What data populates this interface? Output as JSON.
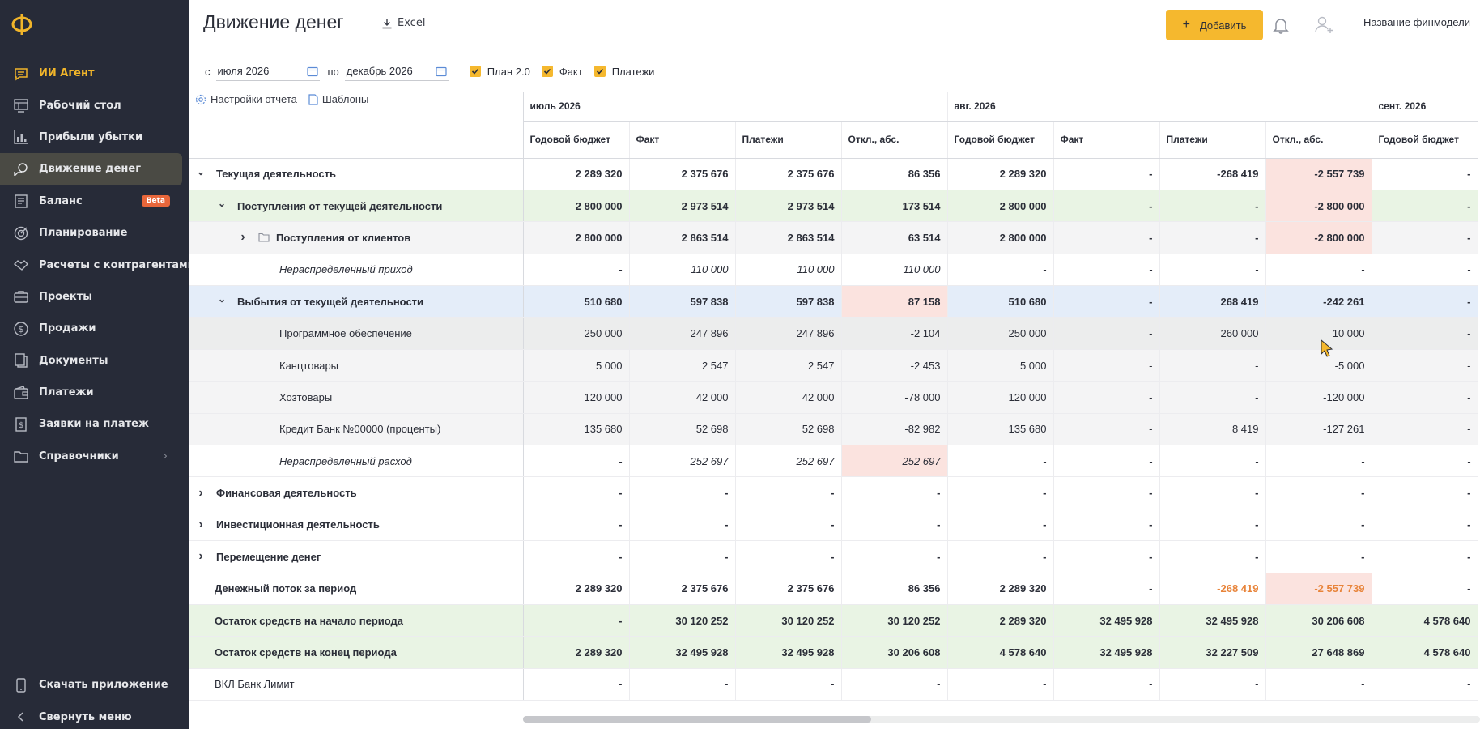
{
  "sidebar": {
    "items": [
      {
        "label": "ИИ Агент",
        "icon": "chat-icon"
      },
      {
        "label": "Рабочий стол",
        "icon": "dashboard-icon"
      },
      {
        "label": "Прибыли убытки",
        "icon": "bar-chart-icon"
      },
      {
        "label": "Движение денег",
        "icon": "money-flow-icon"
      },
      {
        "label": "Баланс",
        "icon": "balance-icon",
        "badge": "Beta"
      },
      {
        "label": "Планирование",
        "icon": "target-icon"
      },
      {
        "label": "Расчеты с контрагентами",
        "icon": "handshake-icon"
      },
      {
        "label": "Проекты",
        "icon": "briefcase-icon"
      },
      {
        "label": "Продажи",
        "icon": "dollar-icon"
      },
      {
        "label": "Документы",
        "icon": "documents-icon"
      },
      {
        "label": "Платежи",
        "icon": "wallet-icon"
      },
      {
        "label": "Заявки на платеж",
        "icon": "request-icon"
      },
      {
        "label": "Справочники",
        "icon": "folder-icon"
      }
    ],
    "download_app": "Скачать приложение",
    "collapse_menu": "Свернуть меню"
  },
  "header": {
    "title": "Движение денег",
    "excel": "Excel",
    "add_button": "Добавить",
    "model_name": "Название финмодели"
  },
  "filters": {
    "from_label": "с",
    "from_value": "июля 2026",
    "to_label": "по",
    "to_value": "декабрь 2026",
    "checks": [
      "План 2.0",
      "Факт",
      "Платежи"
    ]
  },
  "settings": {
    "report_settings": "Настройки отчета",
    "templates": "Шаблоны"
  },
  "table": {
    "months": [
      "июль 2026",
      "авг. 2026",
      "сент. 2026"
    ],
    "columns": [
      "Годовой бюджет",
      "Факт",
      "Платежи",
      "Откл., абс.",
      "Годовой бюджет",
      "Факт",
      "Платежи",
      "Откл., абс.",
      "Годовой бюджет"
    ],
    "rows": [
      {
        "name": "Текущая деятельность",
        "values": [
          "2 289 320",
          "2 375 676",
          "2 375 676",
          "86 356",
          "2 289 320",
          "-",
          "-268 419",
          "-2 557 739",
          "-"
        ]
      },
      {
        "name": "Поступления от текущей деятельности",
        "values": [
          "2 800 000",
          "2 973 514",
          "2 973 514",
          "173 514",
          "2 800 000",
          "-",
          "-",
          "-2 800 000",
          "-"
        ]
      },
      {
        "name": "Поступления от клиентов",
        "values": [
          "2 800 000",
          "2 863 514",
          "2 863 514",
          "63 514",
          "2 800 000",
          "-",
          "-",
          "-2 800 000",
          "-"
        ]
      },
      {
        "name": "Нераспределенный приход",
        "values": [
          "-",
          "110 000",
          "110 000",
          "110 000",
          "-",
          "-",
          "-",
          "-",
          "-"
        ]
      },
      {
        "name": "Выбытия от текущей деятельности",
        "values": [
          "510 680",
          "597 838",
          "597 838",
          "87 158",
          "510 680",
          "-",
          "268 419",
          "-242 261",
          "-"
        ]
      },
      {
        "name": "Программное обеспечение",
        "values": [
          "250 000",
          "247 896",
          "247 896",
          "-2 104",
          "250 000",
          "-",
          "260 000",
          "10 000",
          "-"
        ]
      },
      {
        "name": "Канцтовары",
        "values": [
          "5 000",
          "2 547",
          "2 547",
          "-2 453",
          "5 000",
          "-",
          "-",
          "-5 000",
          "-"
        ]
      },
      {
        "name": "Хозтовары",
        "values": [
          "120 000",
          "42 000",
          "42 000",
          "-78 000",
          "120 000",
          "-",
          "-",
          "-120 000",
          "-"
        ]
      },
      {
        "name": "Кредит Банк №00000 (проценты)",
        "values": [
          "135 680",
          "52 698",
          "52 698",
          "-82 982",
          "135 680",
          "-",
          "8 419",
          "-127 261",
          "-"
        ]
      },
      {
        "name": "Нераспределенный расход",
        "values": [
          "-",
          "252 697",
          "252 697",
          "252 697",
          "-",
          "-",
          "-",
          "-",
          "-"
        ]
      },
      {
        "name": "Финансовая деятельность",
        "values": [
          "-",
          "-",
          "-",
          "-",
          "-",
          "-",
          "-",
          "-",
          "-"
        ]
      },
      {
        "name": "Инвестиционная деятельность",
        "values": [
          "-",
          "-",
          "-",
          "-",
          "-",
          "-",
          "-",
          "-",
          "-"
        ]
      },
      {
        "name": "Перемещение денег",
        "values": [
          "-",
          "-",
          "-",
          "-",
          "-",
          "-",
          "-",
          "-",
          "-"
        ]
      },
      {
        "name": "Денежный поток за период",
        "values": [
          "2 289 320",
          "2 375 676",
          "2 375 676",
          "86 356",
          "2 289 320",
          "-",
          "-268 419",
          "-2 557 739",
          "-"
        ]
      },
      {
        "name": "Остаток средств на начало периода",
        "values": [
          "-",
          "30 120 252",
          "30 120 252",
          "30 120 252",
          "2 289 320",
          "32 495 928",
          "32 495 928",
          "30 206 608",
          "4 578 640"
        ]
      },
      {
        "name": "Остаток средств на конец периода",
        "values": [
          "2 289 320",
          "32 495 928",
          "32 495 928",
          "30 206 608",
          "4 578 640",
          "32 495 928",
          "32 227 509",
          "27 648 869",
          "4 578 640"
        ]
      },
      {
        "name": "ВКЛ Банк Лимит",
        "values": [
          "-",
          "-",
          "-",
          "-",
          "-",
          "-",
          "-",
          "-",
          "-"
        ]
      }
    ]
  }
}
